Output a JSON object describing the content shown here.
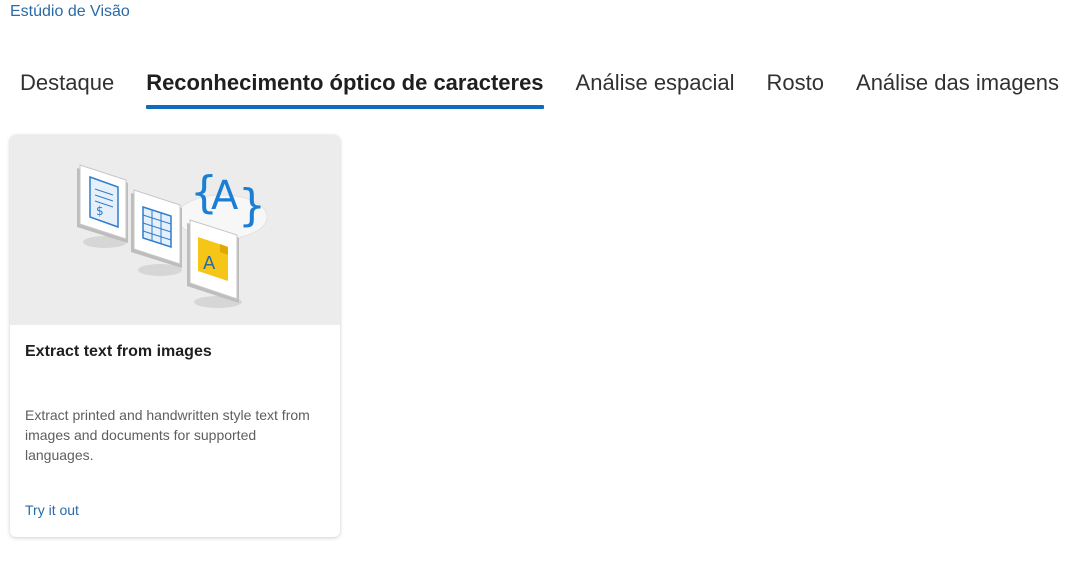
{
  "breadcrumb": {
    "label": "Estúdio de Visão"
  },
  "tabs": [
    {
      "label": "Destaque",
      "active": false
    },
    {
      "label": "Reconhecimento óptico de caracteres",
      "active": true
    },
    {
      "label": "Análise espacial",
      "active": false
    },
    {
      "label": "Rosto",
      "active": false
    },
    {
      "label": "Análise das imagens",
      "active": false
    }
  ],
  "colors": {
    "accent": "#0f6cbd",
    "link": "#2a6aa7",
    "hero_background": "#ececec"
  },
  "cards": [
    {
      "illustration": "ocr-illustration",
      "illustration_glyph": "{A}",
      "title": "Extract text from images",
      "description": "Extract printed and handwritten style text from images and documents for supported languages.",
      "link_label": "Try it out"
    }
  ]
}
